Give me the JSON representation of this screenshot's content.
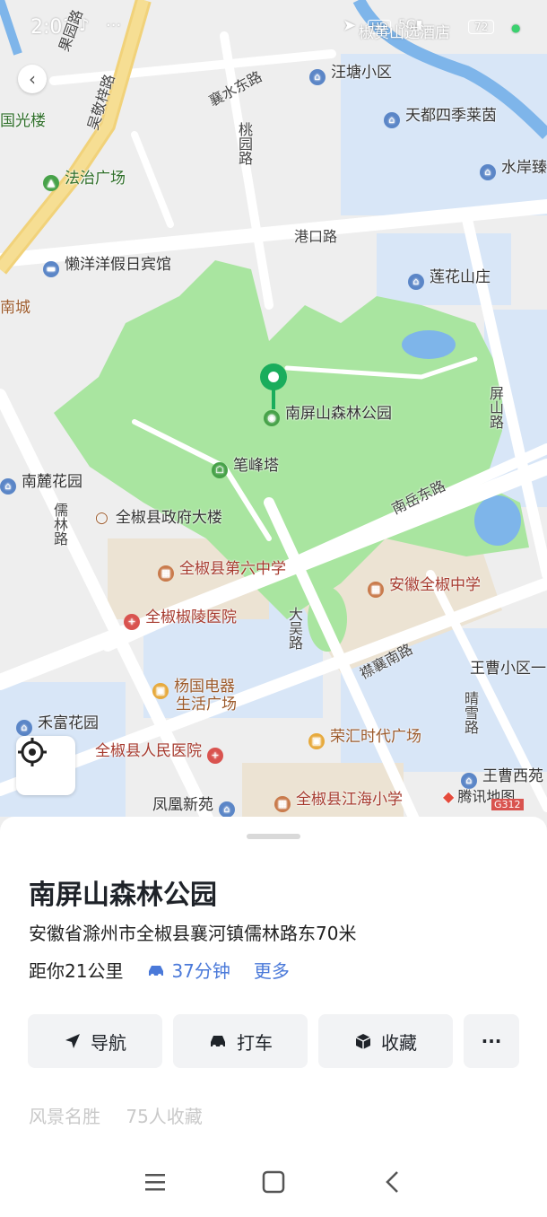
{
  "status_bar": {
    "time": "2:01",
    "battery": "72"
  },
  "map": {
    "labels": {
      "guogu": "果园路",
      "wuqiao": "吴敬梓路",
      "xiangshui": "襄水东路",
      "wangtang": "汪塘小区",
      "tiandu": "天都四季莱茵",
      "guangnian": "国光楼",
      "taoyuan": "桃园路",
      "shuian": "水岸臻",
      "fazhi": "法治广场",
      "gangkou": "港口路",
      "lanyang": "懒洋洋假日宾馆",
      "lianhua": "莲花山庄",
      "nancheng": "南城",
      "pingshan": "屏山路",
      "park": "南屏山森林公园",
      "bifeng": "笔峰塔",
      "nanlu": "南麓花园",
      "nanyue": "南岳东路",
      "rulin": "儒林路",
      "gov": "全椒县政府大楼",
      "no6": "全椒县第六中学",
      "anhui": "安徽全椒中学",
      "hospital_jl": "全椒椒陵医院",
      "dawu": "大吴路",
      "xiangnan": "襟襄南路",
      "wangcao1": "王曹小区一",
      "yangguo1": "杨国电器",
      "yangguo2": "生活广场",
      "qinglu": "晴雪路",
      "hefu": "禾富花园",
      "ronghui": "荣汇时代广场",
      "renmin": "全椒县人民医院",
      "wangcao2": "王曹西苑",
      "fenghuang": "凤凰新苑",
      "jianghai": "全椒县江海小学",
      "brand": "腾讯地图",
      "top_right": "椒黄山选酒店",
      "g312": "G312"
    }
  },
  "place": {
    "name": "南屏山森林公园",
    "address": "安徽省滁州市全椒县襄河镇儒林路东70米",
    "distance": "距你21公里",
    "drive_time": "37分钟",
    "more": "更多",
    "category": "风景名胜",
    "favorites": "75人收藏"
  },
  "actions": {
    "navigate": "导航",
    "taxi": "打车",
    "favorite": "收藏",
    "more": "···"
  },
  "colors": {
    "accent": "#4a79d9",
    "park_green": "#a9e5a0",
    "pin_green": "#1aad5c"
  }
}
